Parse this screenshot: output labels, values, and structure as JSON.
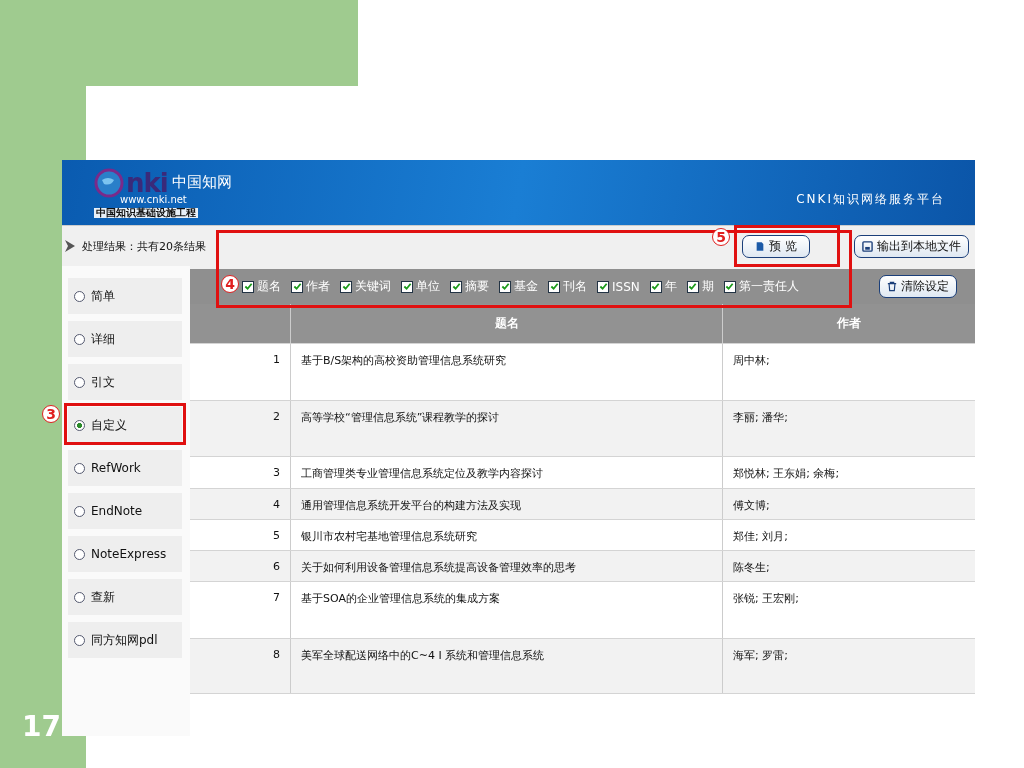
{
  "slide": {
    "number": "17"
  },
  "header": {
    "logo_mark": "nki",
    "logo_cn": "中国知网",
    "logo_url": "www.cnki.net",
    "logo_sub": "中国知识基础设施工程",
    "platform": "CNKI知识网络服务平台"
  },
  "toolbar": {
    "result_text": "处理结果：共有20条结果",
    "buttons": [
      {
        "label": "预 览",
        "kind": "preview"
      },
      {
        "label": "输出到本地文件",
        "kind": "save"
      }
    ]
  },
  "sidebar": {
    "items": [
      {
        "label": "简单",
        "selected": false
      },
      {
        "label": "详细",
        "selected": false
      },
      {
        "label": "引文",
        "selected": false
      },
      {
        "label": "自定义",
        "selected": true
      },
      {
        "label": "RefWork",
        "selected": false
      },
      {
        "label": "EndNote",
        "selected": false
      },
      {
        "label": "NoteExpress",
        "selected": false
      },
      {
        "label": "查新",
        "selected": false
      },
      {
        "label": "同方知网pdl",
        "selected": false
      }
    ]
  },
  "fields": {
    "items": [
      {
        "label": "题名",
        "checked": true
      },
      {
        "label": "作者",
        "checked": true
      },
      {
        "label": "关键词",
        "checked": true
      },
      {
        "label": "单位",
        "checked": true
      },
      {
        "label": "摘要",
        "checked": true
      },
      {
        "label": "基金",
        "checked": true
      },
      {
        "label": "刊名",
        "checked": true
      },
      {
        "label": "ISSN",
        "checked": true
      },
      {
        "label": "年",
        "checked": true
      },
      {
        "label": "期",
        "checked": true
      },
      {
        "label": "第一责任人",
        "checked": true
      }
    ],
    "clear_button": "清除设定"
  },
  "table": {
    "columns": [
      "题名",
      "作者"
    ],
    "rows": [
      {
        "index": "1",
        "title": "基于B/S架构的高校资助管理信息系统研究",
        "author": "周中林;"
      },
      {
        "index": "2",
        "title": "高等学校“管理信息系统”课程教学的探讨",
        "author": "李丽; 潘华;"
      },
      {
        "index": "3",
        "title": "工商管理类专业管理信息系统定位及教学内容探讨",
        "author": "郑悦林; 王东娟; 余梅;"
      },
      {
        "index": "4",
        "title": "通用管理信息系统开发平台的构建方法及实现",
        "author": "傅文博;"
      },
      {
        "index": "5",
        "title": "银川市农村宅基地管理信息系统研究",
        "author": "郑佳; 刘月;"
      },
      {
        "index": "6",
        "title": "关于如何利用设备管理信息系统提高设备管理效率的思考",
        "author": "陈冬生;"
      },
      {
        "index": "7",
        "title": "基于SOA的企业管理信息系统的集成方案",
        "author": "张锐; 王宏刚;"
      },
      {
        "index": "8",
        "title": "美军全球配送网络中的C~4 I 系统和管理信息系统",
        "author": "海军; 罗雷;"
      }
    ]
  },
  "annotations": [
    {
      "number": "3"
    },
    {
      "number": "4"
    },
    {
      "number": "5"
    }
  ]
}
